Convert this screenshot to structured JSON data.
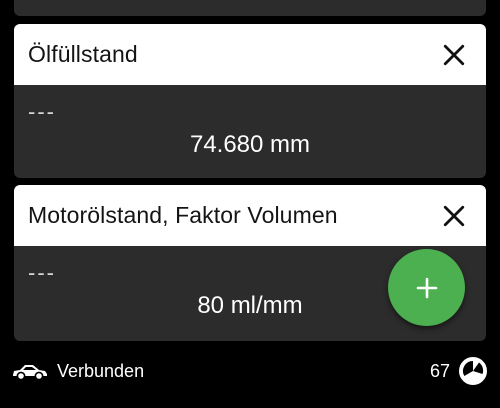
{
  "cards": [
    {
      "title": "Ölfüllstand",
      "subvalue": "---",
      "value": "74.680 mm"
    },
    {
      "title": "Motorölstand, Faktor Volumen",
      "subvalue": "---",
      "value": "80 ml/mm"
    }
  ],
  "icons": {
    "close": "close-icon",
    "add": "plus-icon",
    "car": "car-icon",
    "status": "pie-chart-icon"
  },
  "status": {
    "connection": "Verbunden",
    "count": "67"
  },
  "colors": {
    "background": "#000000",
    "card_body": "#2c2c2c",
    "card_header": "#ffffff",
    "fab": "#4caf50"
  }
}
